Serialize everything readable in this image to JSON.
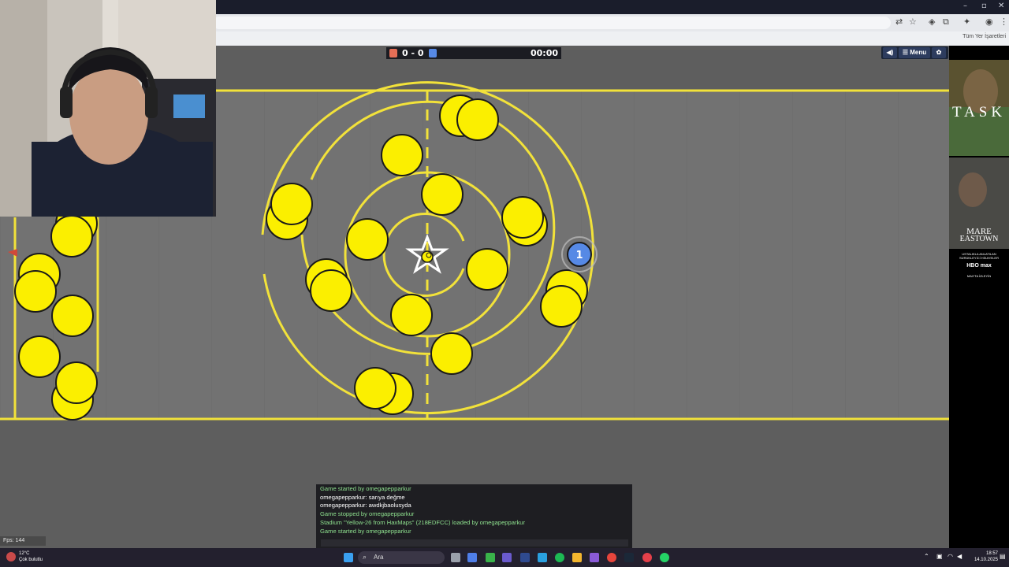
{
  "browser": {
    "bookmarks_label": "Tüm Yer İşaretleri"
  },
  "scoreboard": {
    "score": "0 - 0",
    "time": "00:00",
    "red_color": "#e56e56",
    "blue_color": "#5689e5"
  },
  "controls": {
    "sound_icon": "speaker-icon",
    "menu_label": "☰ Menu",
    "settings_icon": "gear-icon"
  },
  "player": {
    "number": "1"
  },
  "chat": {
    "lines": [
      {
        "type": "sys",
        "text": "Game started by omegapepparkur"
      },
      {
        "type": "msg",
        "text": "omegapepparkur: sarıya değme"
      },
      {
        "type": "msg",
        "text": "omegapepparkur: awdkjbaolusyda"
      },
      {
        "type": "sys",
        "text": "Game stopped by omegapepparkur"
      },
      {
        "type": "sys",
        "text": "Stadium \"Yellow-26 from HaxMaps\" (218EDFCC) loaded by omegapepparkur"
      },
      {
        "type": "sys",
        "text": "Game started by omegapepparkur"
      }
    ]
  },
  "fps": "Fps: 144",
  "ad": {
    "title1": "TASK",
    "title2": "MARE",
    "title3": "EASTOWN",
    "line1": "USTALIKLA ANLATILAN",
    "line2": "SÜRÜKLEYİCİ HİKAYELER",
    "brand": "HBO max",
    "sub": "MAX'TA İZLEYİN"
  },
  "taskbar": {
    "temp": "12°C",
    "weather": "Çok bulutlu",
    "search_placeholder": "Ara",
    "time": "18:57",
    "date": "14.10.2025"
  }
}
